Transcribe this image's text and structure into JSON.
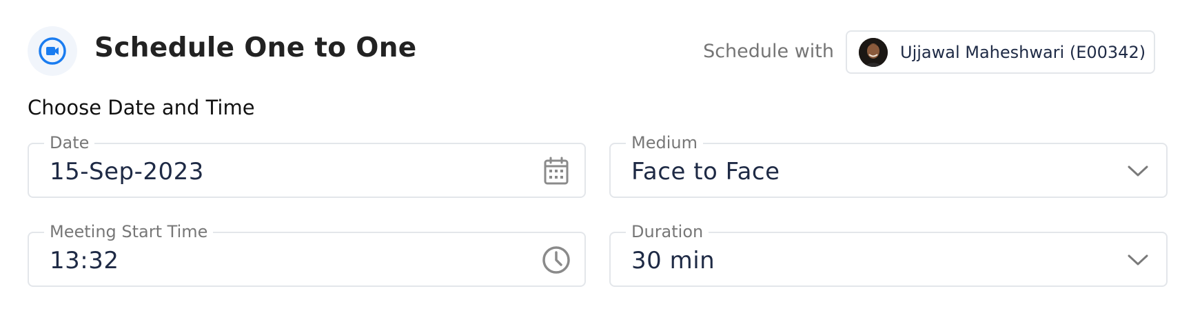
{
  "header": {
    "title": "Schedule One to One",
    "icon": "video-camera-icon",
    "accent_color": "#1a7cf0"
  },
  "schedule_with": {
    "label": "Schedule with",
    "participant": "Ujjawal Maheshwari (E00342)"
  },
  "section": {
    "title": "Choose Date and Time"
  },
  "fields": {
    "date": {
      "label": "Date",
      "value": "15-Sep-2023",
      "icon": "calendar-icon"
    },
    "medium": {
      "label": "Medium",
      "value": "Face to Face",
      "icon": "chevron-down-icon"
    },
    "start_time": {
      "label": "Meeting Start Time",
      "value": "13:32",
      "icon": "clock-icon"
    },
    "duration": {
      "label": "Duration",
      "value": "30 min",
      "icon": "chevron-down-icon"
    }
  }
}
